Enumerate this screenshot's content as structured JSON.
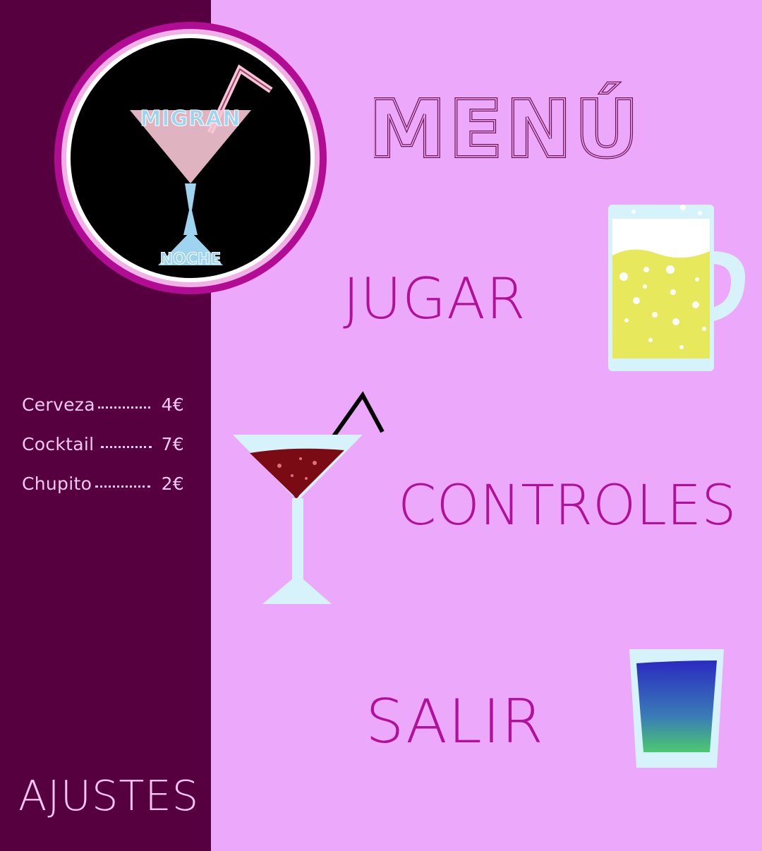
{
  "logo": {
    "top_text": "MIGRAN",
    "bottom_text": "NOCHE",
    "icon": "cocktail-glass-logo-icon"
  },
  "title": "MENÚ",
  "menu": {
    "play_label": "JUGAR",
    "controls_label": "CONTROLES",
    "exit_label": "SALIR",
    "settings_label": "AJUSTES"
  },
  "prices": [
    {
      "name": "Cerveza",
      "price": "4€"
    },
    {
      "name": "Cocktail",
      "price": "7€"
    },
    {
      "name": "Chupito",
      "price": "2€"
    }
  ],
  "icons": {
    "beer": "beer-mug-icon",
    "cocktail": "cocktail-glass-icon",
    "shot": "shot-glass-icon"
  },
  "colors": {
    "background": "#eca8fb",
    "sidebar": "#570040",
    "accent": "#b1109a",
    "title": "#6e1452",
    "settings_text": "#ffc6f8"
  }
}
